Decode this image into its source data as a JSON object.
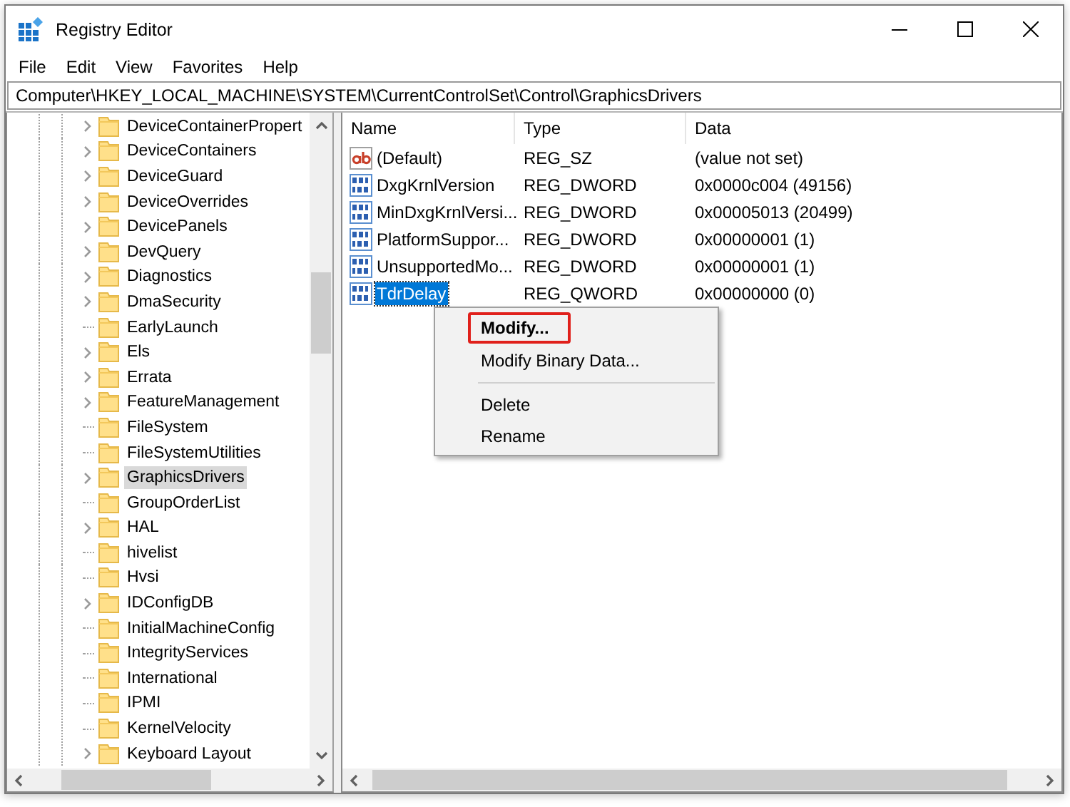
{
  "window": {
    "title": "Registry Editor"
  },
  "menu": [
    "File",
    "Edit",
    "View",
    "Favorites",
    "Help"
  ],
  "address": "Computer\\HKEY_LOCAL_MACHINE\\SYSTEM\\CurrentControlSet\\Control\\GraphicsDrivers",
  "tree": [
    {
      "label": "DeviceContainerPropert",
      "expandable": true,
      "selected": false
    },
    {
      "label": "DeviceContainers",
      "expandable": true,
      "selected": false
    },
    {
      "label": "DeviceGuard",
      "expandable": true,
      "selected": false
    },
    {
      "label": "DeviceOverrides",
      "expandable": true,
      "selected": false
    },
    {
      "label": "DevicePanels",
      "expandable": true,
      "selected": false
    },
    {
      "label": "DevQuery",
      "expandable": true,
      "selected": false
    },
    {
      "label": "Diagnostics",
      "expandable": true,
      "selected": false
    },
    {
      "label": "DmaSecurity",
      "expandable": true,
      "selected": false
    },
    {
      "label": "EarlyLaunch",
      "expandable": false,
      "selected": false
    },
    {
      "label": "Els",
      "expandable": true,
      "selected": false
    },
    {
      "label": "Errata",
      "expandable": true,
      "selected": false
    },
    {
      "label": "FeatureManagement",
      "expandable": true,
      "selected": false
    },
    {
      "label": "FileSystem",
      "expandable": false,
      "selected": false
    },
    {
      "label": "FileSystemUtilities",
      "expandable": false,
      "selected": false
    },
    {
      "label": "GraphicsDrivers",
      "expandable": true,
      "selected": true
    },
    {
      "label": "GroupOrderList",
      "expandable": false,
      "selected": false
    },
    {
      "label": "HAL",
      "expandable": true,
      "selected": false
    },
    {
      "label": "hivelist",
      "expandable": false,
      "selected": false
    },
    {
      "label": "Hvsi",
      "expandable": false,
      "selected": false
    },
    {
      "label": "IDConfigDB",
      "expandable": true,
      "selected": false
    },
    {
      "label": "InitialMachineConfig",
      "expandable": false,
      "selected": false
    },
    {
      "label": "IntegrityServices",
      "expandable": false,
      "selected": false
    },
    {
      "label": "International",
      "expandable": false,
      "selected": false
    },
    {
      "label": "IPMI",
      "expandable": false,
      "selected": false
    },
    {
      "label": "KernelVelocity",
      "expandable": false,
      "selected": false
    },
    {
      "label": "Keyboard Layout",
      "expandable": true,
      "selected": false
    }
  ],
  "table": {
    "columns": [
      "Name",
      "Type",
      "Data"
    ],
    "rows": [
      {
        "kind": "string",
        "name": "(Default)",
        "type": "REG_SZ",
        "data": "(value not set)",
        "selected": false
      },
      {
        "kind": "binary",
        "name": "DxgKrnlVersion",
        "type": "REG_DWORD",
        "data": "0x0000c004 (49156)",
        "selected": false
      },
      {
        "kind": "binary",
        "name": "MinDxgKrnlVersi...",
        "type": "REG_DWORD",
        "data": "0x00005013 (20499)",
        "selected": false
      },
      {
        "kind": "binary",
        "name": "PlatformSuppor...",
        "type": "REG_DWORD",
        "data": "0x00000001 (1)",
        "selected": false
      },
      {
        "kind": "binary",
        "name": "UnsupportedMo...",
        "type": "REG_DWORD",
        "data": "0x00000001 (1)",
        "selected": false
      },
      {
        "kind": "binary",
        "name": "TdrDelay",
        "type": "REG_QWORD",
        "data": "0x00000000 (0)",
        "selected": true
      }
    ]
  },
  "context_menu": [
    {
      "kind": "item",
      "label": "Modify...",
      "default": true,
      "highlighted": true
    },
    {
      "kind": "item",
      "label": "Modify Binary Data...",
      "default": false,
      "highlighted": false
    },
    {
      "kind": "separator"
    },
    {
      "kind": "item",
      "label": "Delete",
      "default": false,
      "highlighted": false
    },
    {
      "kind": "item",
      "label": "Rename",
      "default": false,
      "highlighted": false
    }
  ]
}
